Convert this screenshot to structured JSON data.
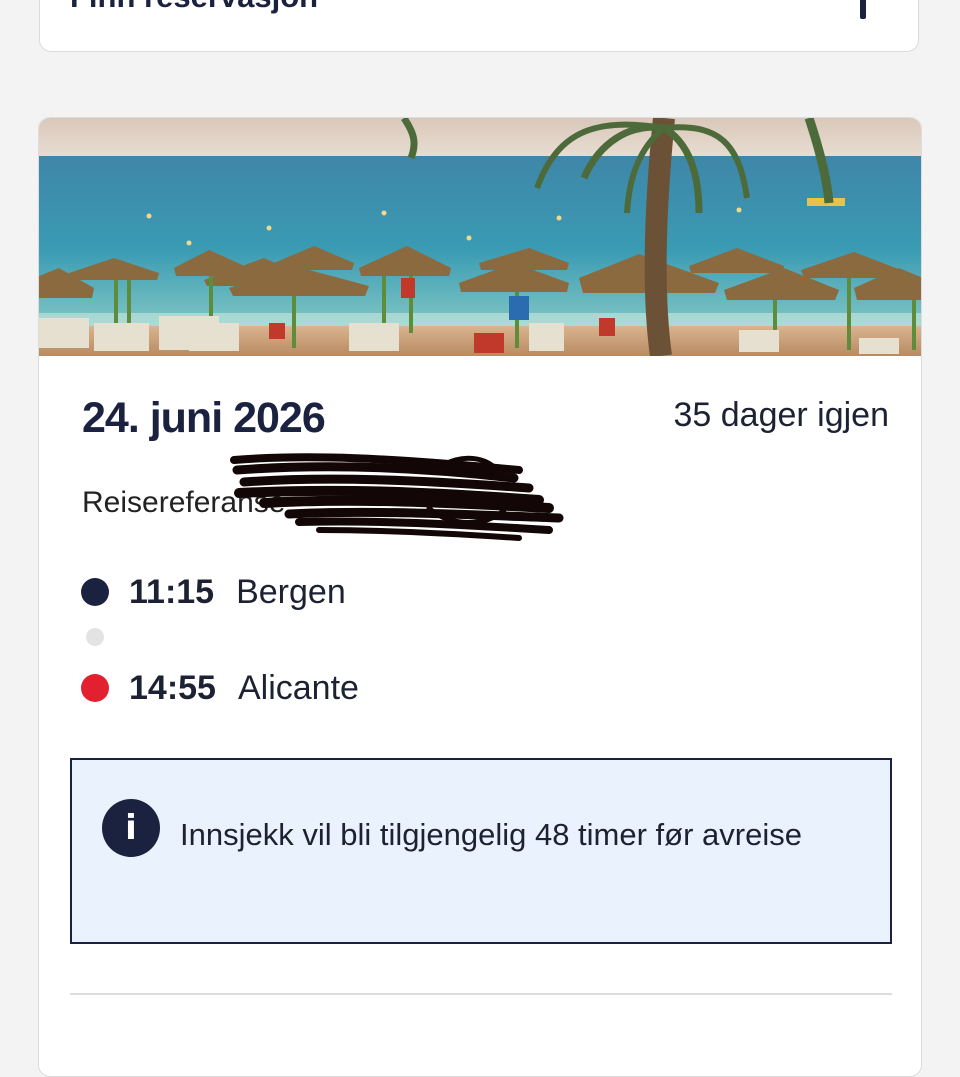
{
  "header": {
    "title": "Finn reservasjon"
  },
  "trip": {
    "date": "24. juni 2026",
    "days_left": "35 dager igjen",
    "reference_label": "Reisereferanse",
    "departure": {
      "time": "11:15",
      "city": "Bergen",
      "color": "#1a2240"
    },
    "arrival": {
      "time": "14:55",
      "city": "Alicante",
      "color": "#e3202f"
    },
    "info": {
      "icon": "info-icon",
      "text": "Innsjekk vil bli tilgjengelig 48 timer før avreise"
    }
  }
}
